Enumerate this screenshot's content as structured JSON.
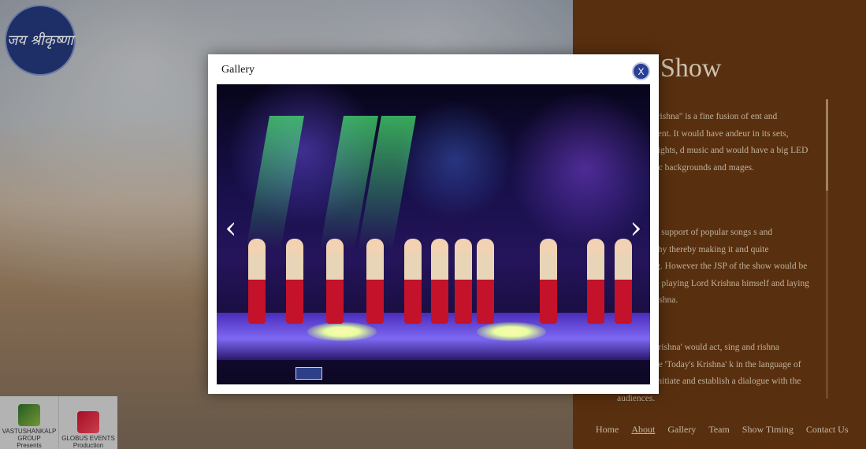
{
  "background": {
    "logo_text": "जय श्रीकृष्णा",
    "show_title": "Show",
    "paragraphs": [
      "\"Jai Shri Krishna\" is a fine fusion of ent and enlightenment. It would have andeur in its sets, costumes, lights, d music and would have a big LED roject scenic backgrounds and mages.",
      "would have support of popular songs s and choreography thereby making it and quite entertaining. However the JSP of the show would be the two one playing Lord Krishna himself and laying Today's Krishna.",
      "the 'Lord Krishna' would act, sing and rishna himself. The 'Today's Krishna' k in the language of the day to initiate and establish a dialogue with the audiences."
    ],
    "nav": [
      {
        "label": "Home"
      },
      {
        "label": "About"
      },
      {
        "label": "Gallery"
      },
      {
        "label": "Team"
      },
      {
        "label": "Show Timing"
      },
      {
        "label": "Contact Us"
      }
    ],
    "sponsors": [
      {
        "name": "VASTUSHANKALP GROUP",
        "caption": "Presents"
      },
      {
        "name": "GLOBUS EVENTS",
        "caption": "Production"
      }
    ]
  },
  "modal": {
    "title": "Gallery",
    "close_label": "X",
    "prev_icon": "chevron-left-icon",
    "next_icon": "chevron-right-icon",
    "image_alt": "Stage performance"
  }
}
